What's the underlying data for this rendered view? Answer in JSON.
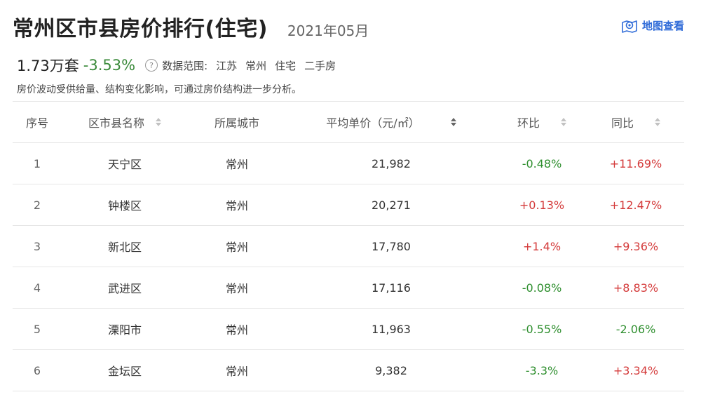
{
  "header": {
    "title": "常州区市县房价排行(住宅)",
    "date": "2021年05月",
    "map_link": "地图查看"
  },
  "summary": {
    "count": "1.73万套",
    "change": "-3.53%",
    "help_icon": "?",
    "scope_label": "数据范围:",
    "scope": [
      "江苏",
      "常州",
      "住宅",
      "二手房"
    ]
  },
  "note": "房价波动受供给量、结构变化影响，可通过房价结构进一步分析。",
  "table": {
    "columns": [
      "序号",
      "区市县名称",
      "所属城市",
      "平均单价（元/㎡）",
      "环比",
      "同比"
    ],
    "rows": [
      {
        "rank": "1",
        "name": "天宁区",
        "city": "常州",
        "price": "21,982",
        "mom": "-0.48%",
        "yoy": "+11.69%"
      },
      {
        "rank": "2",
        "name": "钟楼区",
        "city": "常州",
        "price": "20,271",
        "mom": "+0.13%",
        "yoy": "+12.47%"
      },
      {
        "rank": "3",
        "name": "新北区",
        "city": "常州",
        "price": "17,780",
        "mom": "+1.4%",
        "yoy": "+9.36%"
      },
      {
        "rank": "4",
        "name": "武进区",
        "city": "常州",
        "price": "17,116",
        "mom": "-0.08%",
        "yoy": "+8.83%"
      },
      {
        "rank": "5",
        "name": "溧阳市",
        "city": "常州",
        "price": "11,963",
        "mom": "-0.55%",
        "yoy": "-2.06%"
      },
      {
        "rank": "6",
        "name": "金坛区",
        "city": "常州",
        "price": "9,382",
        "mom": "-3.3%",
        "yoy": "+3.34%"
      }
    ]
  },
  "colors": {
    "up": "#d43a3a",
    "down": "#2f8f2f",
    "link": "#2f6bd8"
  }
}
